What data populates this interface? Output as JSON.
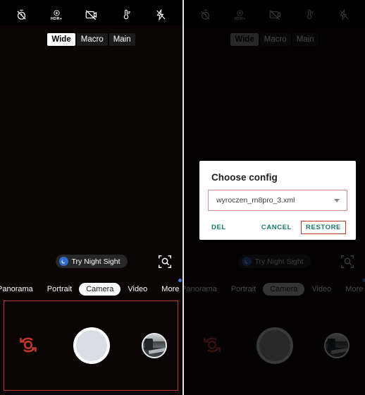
{
  "app": {
    "name": "gcam-camera",
    "accent_teal": "#1a7a6e",
    "annotation_red": "#c0392b",
    "blue_dot": "#3d7ddb"
  },
  "topbar": {
    "icons": [
      {
        "name": "timer-off-icon",
        "label": "Timer off"
      },
      {
        "name": "hdr-plus-icon",
        "label": "HDR+",
        "caption": "HDR+"
      },
      {
        "name": "motion-off-icon",
        "label": "Motion off"
      },
      {
        "name": "white-balance-icon",
        "label": "White balance"
      },
      {
        "name": "flash-off-icon",
        "label": "Flash off"
      }
    ]
  },
  "lens_selector": {
    "options": [
      {
        "label": "Wide",
        "selected": true
      },
      {
        "label": "Macro",
        "selected": false
      },
      {
        "label": "Main",
        "selected": false
      }
    ]
  },
  "night_sight": {
    "label": "Try Night Sight",
    "icon": "moon-icon"
  },
  "zoom_control": {
    "icon": "magnifier-expand-icon"
  },
  "mode_tabs": [
    {
      "label": "Panorama",
      "selected": false
    },
    {
      "label": "Portrait",
      "selected": false
    },
    {
      "label": "Camera",
      "selected": true
    },
    {
      "label": "Video",
      "selected": false
    },
    {
      "label": "More",
      "selected": false,
      "badge": true
    }
  ],
  "shutter_bar": {
    "flip_icon": "flip-camera-icon",
    "shutter_icon": "shutter-button",
    "gallery_icon": "gallery-thumbnail"
  },
  "dialog": {
    "title": "Choose config",
    "select": {
      "value": "wyroczen_rn8pro_3.xml",
      "caret": "chevron-down-icon"
    },
    "buttons": {
      "del": "DEL",
      "cancel": "CANCEL",
      "restore": "RESTORE"
    }
  }
}
